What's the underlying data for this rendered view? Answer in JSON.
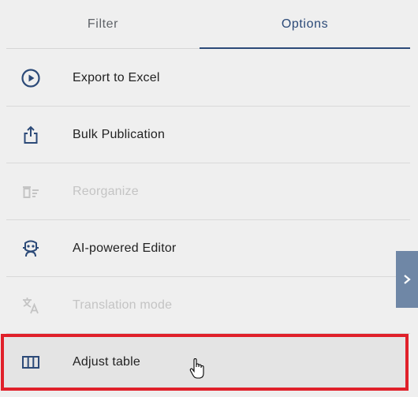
{
  "tabs": [
    {
      "label": "Filter",
      "active": false
    },
    {
      "label": "Options",
      "active": true
    }
  ],
  "menu": {
    "items": [
      {
        "label": "Export to Excel",
        "icon": "play-circle-icon",
        "enabled": true
      },
      {
        "label": "Bulk Publication",
        "icon": "share-upload-icon",
        "enabled": true
      },
      {
        "label": "Reorganize",
        "icon": "reorganize-icon",
        "enabled": false
      },
      {
        "label": "AI-powered Editor",
        "icon": "robot-icon",
        "enabled": true
      },
      {
        "label": "Translation mode",
        "icon": "translate-icon",
        "enabled": false
      },
      {
        "label": "Adjust table",
        "icon": "table-columns-icon",
        "enabled": true,
        "highlighted": true
      }
    ]
  },
  "colors": {
    "accent": "#2c4a78",
    "highlight": "#e0202a",
    "disabled": "#c4c4c4",
    "side_toggle": "#6f87a6"
  }
}
